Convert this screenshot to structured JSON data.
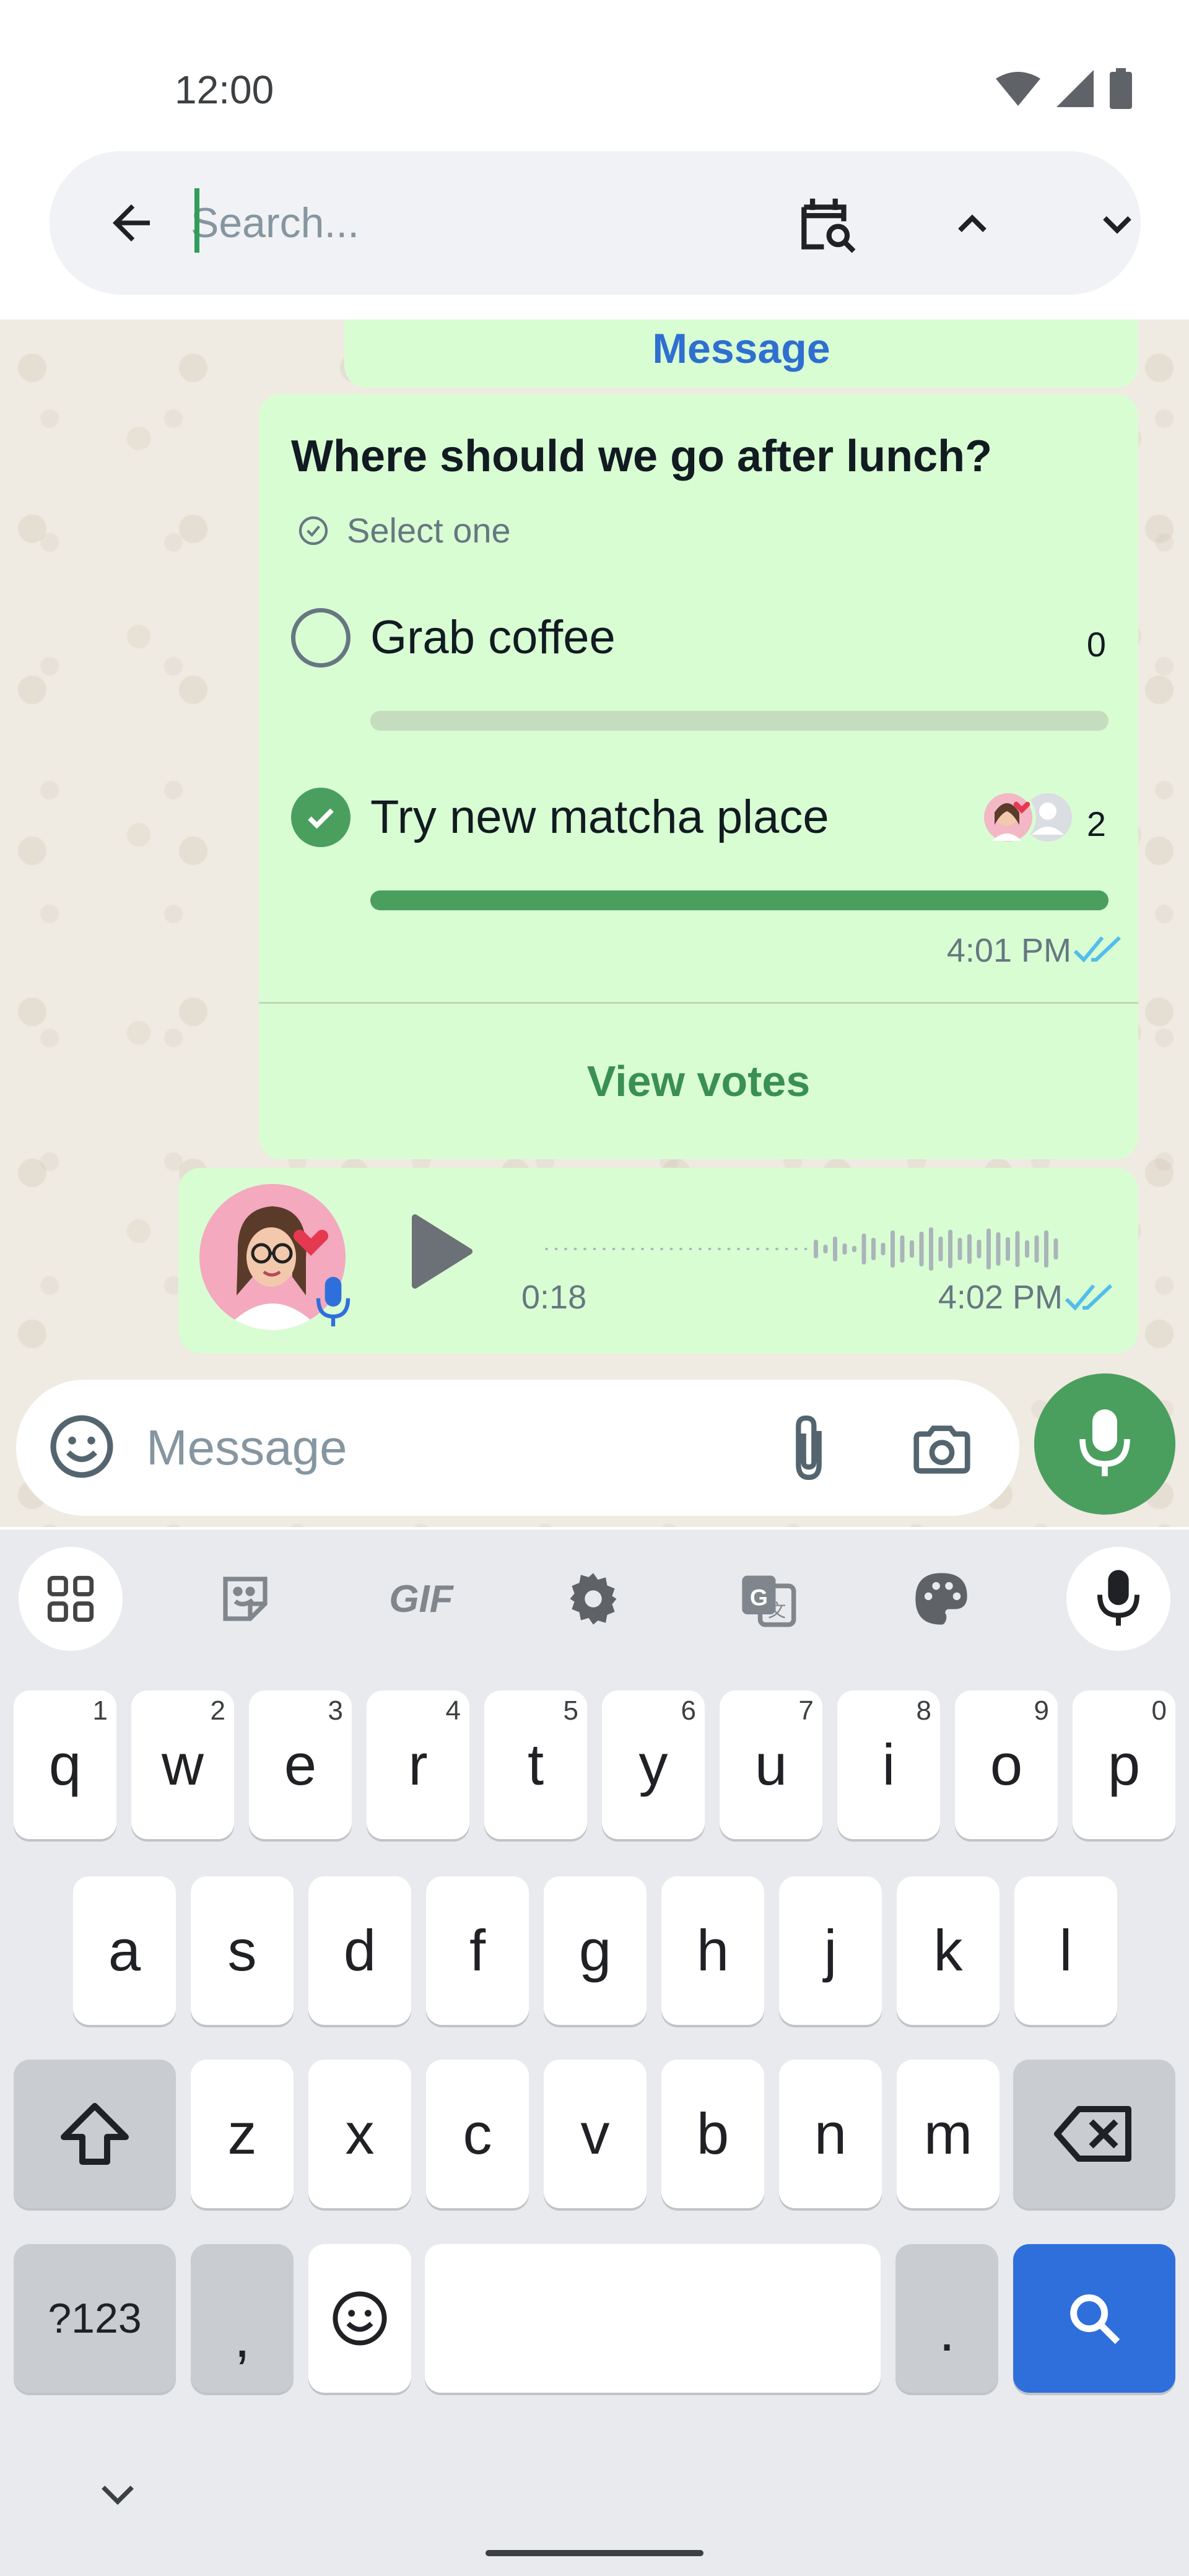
{
  "status_bar": {
    "time": "12:00"
  },
  "search": {
    "placeholder": "Search..."
  },
  "chat": {
    "previous_message_link": "Message",
    "poll": {
      "question": "Where should we go after lunch?",
      "hint": "Select one",
      "options": [
        {
          "label": "Grab coffee",
          "votes": "0",
          "share": 0,
          "selected": false
        },
        {
          "label": "Try new matcha place",
          "votes": "2",
          "share": 1,
          "selected": true
        }
      ],
      "time": "4:01 PM",
      "view_votes_label": "View votes"
    },
    "voice_note": {
      "duration": "0:18",
      "time": "4:02 PM",
      "progress": 0
    }
  },
  "composer": {
    "placeholder": "Message"
  },
  "keyboard": {
    "toolbar": [
      "apps-icon",
      "sticker-icon",
      "gif-icon",
      "settings-icon",
      "translate-icon",
      "palette-icon",
      "mic-icon"
    ],
    "gif_label": "GIF",
    "row1": [
      {
        "key": "q",
        "hint": "1"
      },
      {
        "key": "w",
        "hint": "2"
      },
      {
        "key": "e",
        "hint": "3"
      },
      {
        "key": "r",
        "hint": "4"
      },
      {
        "key": "t",
        "hint": "5"
      },
      {
        "key": "y",
        "hint": "6"
      },
      {
        "key": "u",
        "hint": "7"
      },
      {
        "key": "i",
        "hint": "8"
      },
      {
        "key": "o",
        "hint": "9"
      },
      {
        "key": "p",
        "hint": "0"
      }
    ],
    "row2": [
      "a",
      "s",
      "d",
      "f",
      "g",
      "h",
      "j",
      "k",
      "l"
    ],
    "row3": [
      "z",
      "x",
      "c",
      "v",
      "b",
      "n",
      "m"
    ],
    "symbols_label": "?123",
    "comma": ",",
    "period": "."
  },
  "colors": {
    "accent_green": "#4a9f5f",
    "bubble_green": "#d9fdd3",
    "read_tick_blue": "#53bdeb",
    "search_key_blue": "#2f6fdc"
  }
}
